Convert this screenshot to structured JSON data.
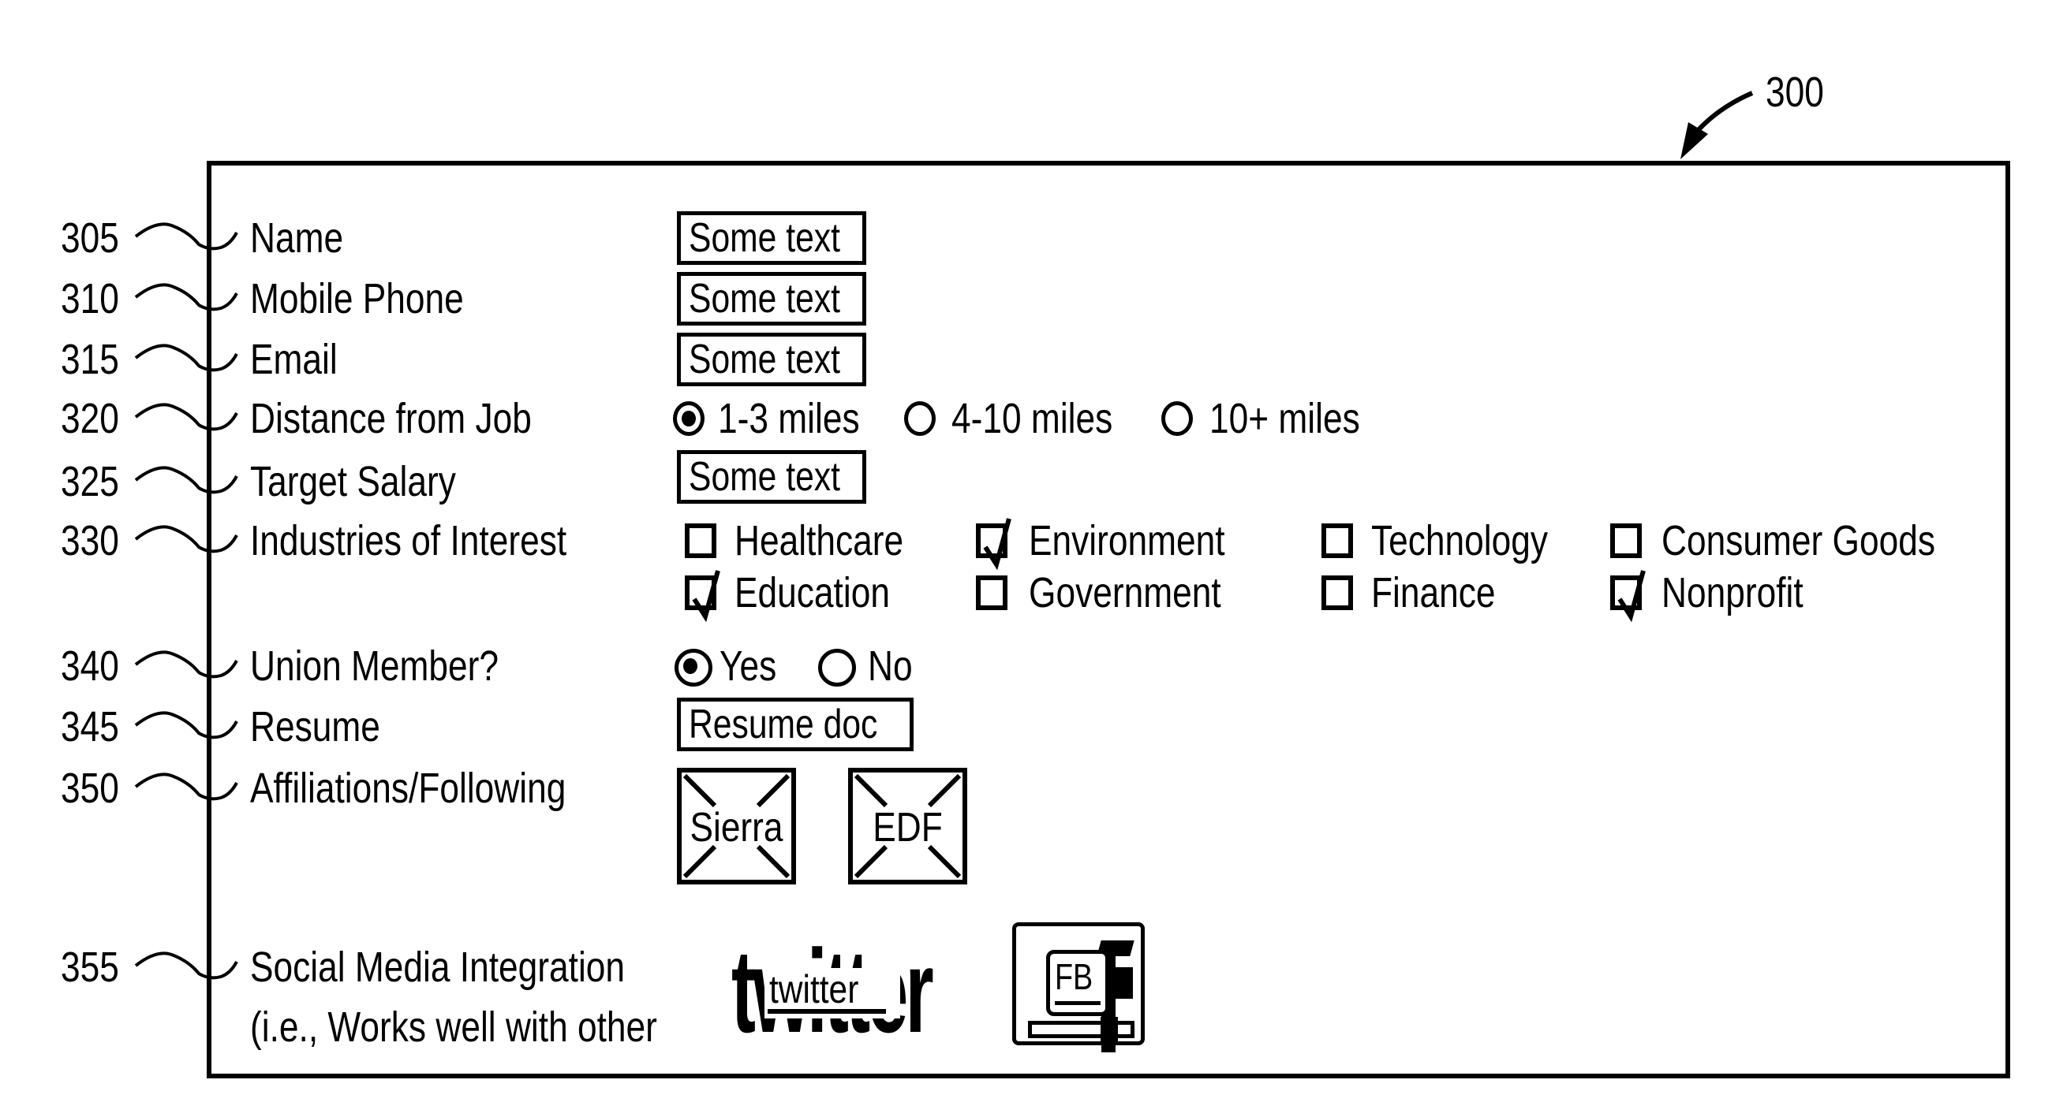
{
  "figure": {
    "reference_number": "300"
  },
  "rows": [
    {
      "ref": "305",
      "label": "Name",
      "field": {
        "type": "text",
        "value": "Some text"
      }
    },
    {
      "ref": "310",
      "label": "Mobile Phone",
      "field": {
        "type": "text",
        "value": "Some text"
      }
    },
    {
      "ref": "315",
      "label": "Email",
      "field": {
        "type": "text",
        "value": "Some text"
      }
    },
    {
      "ref": "320",
      "label": "Distance from Job",
      "field": {
        "type": "radio",
        "options": [
          {
            "label": "1-3 miles",
            "selected": true
          },
          {
            "label": "4-10 miles",
            "selected": false
          },
          {
            "label": "10+ miles",
            "selected": false
          }
        ]
      }
    },
    {
      "ref": "325",
      "label": "Target Salary",
      "field": {
        "type": "text",
        "value": "Some text"
      }
    },
    {
      "ref": "330",
      "label": "Industries of Interest",
      "field": {
        "type": "checkbox",
        "options": [
          {
            "label": "Healthcare",
            "checked": false
          },
          {
            "label": "Environment",
            "checked": true
          },
          {
            "label": "Technology",
            "checked": false
          },
          {
            "label": "Consumer Goods",
            "checked": false
          },
          {
            "label": "Education",
            "checked": true
          },
          {
            "label": "Government",
            "checked": false
          },
          {
            "label": "Finance",
            "checked": false
          },
          {
            "label": "Nonprofit",
            "checked": true
          }
        ]
      }
    },
    {
      "ref": "340",
      "label": "Union Member?",
      "field": {
        "type": "radio",
        "options": [
          {
            "label": "Yes",
            "selected": true
          },
          {
            "label": "No",
            "selected": false
          }
        ]
      }
    },
    {
      "ref": "345",
      "label": "Resume",
      "field": {
        "type": "file",
        "value": "Resume doc"
      }
    },
    {
      "ref": "350",
      "label": "Affiliations/Following",
      "field": {
        "type": "image-tiles",
        "items": [
          {
            "label": "Sierra",
            "icon": "image-placeholder-icon"
          },
          {
            "label": "EDF",
            "icon": "image-placeholder-icon"
          }
        ]
      }
    },
    {
      "ref": "355",
      "label": "Social Media Integration",
      "label_line2": "(i.e., Works well with other",
      "field": {
        "type": "social",
        "items": [
          {
            "label": "twitter",
            "icon": "twitter-logo-icon"
          },
          {
            "label": "FB",
            "icon": "facebook-logo-icon"
          }
        ]
      }
    }
  ]
}
